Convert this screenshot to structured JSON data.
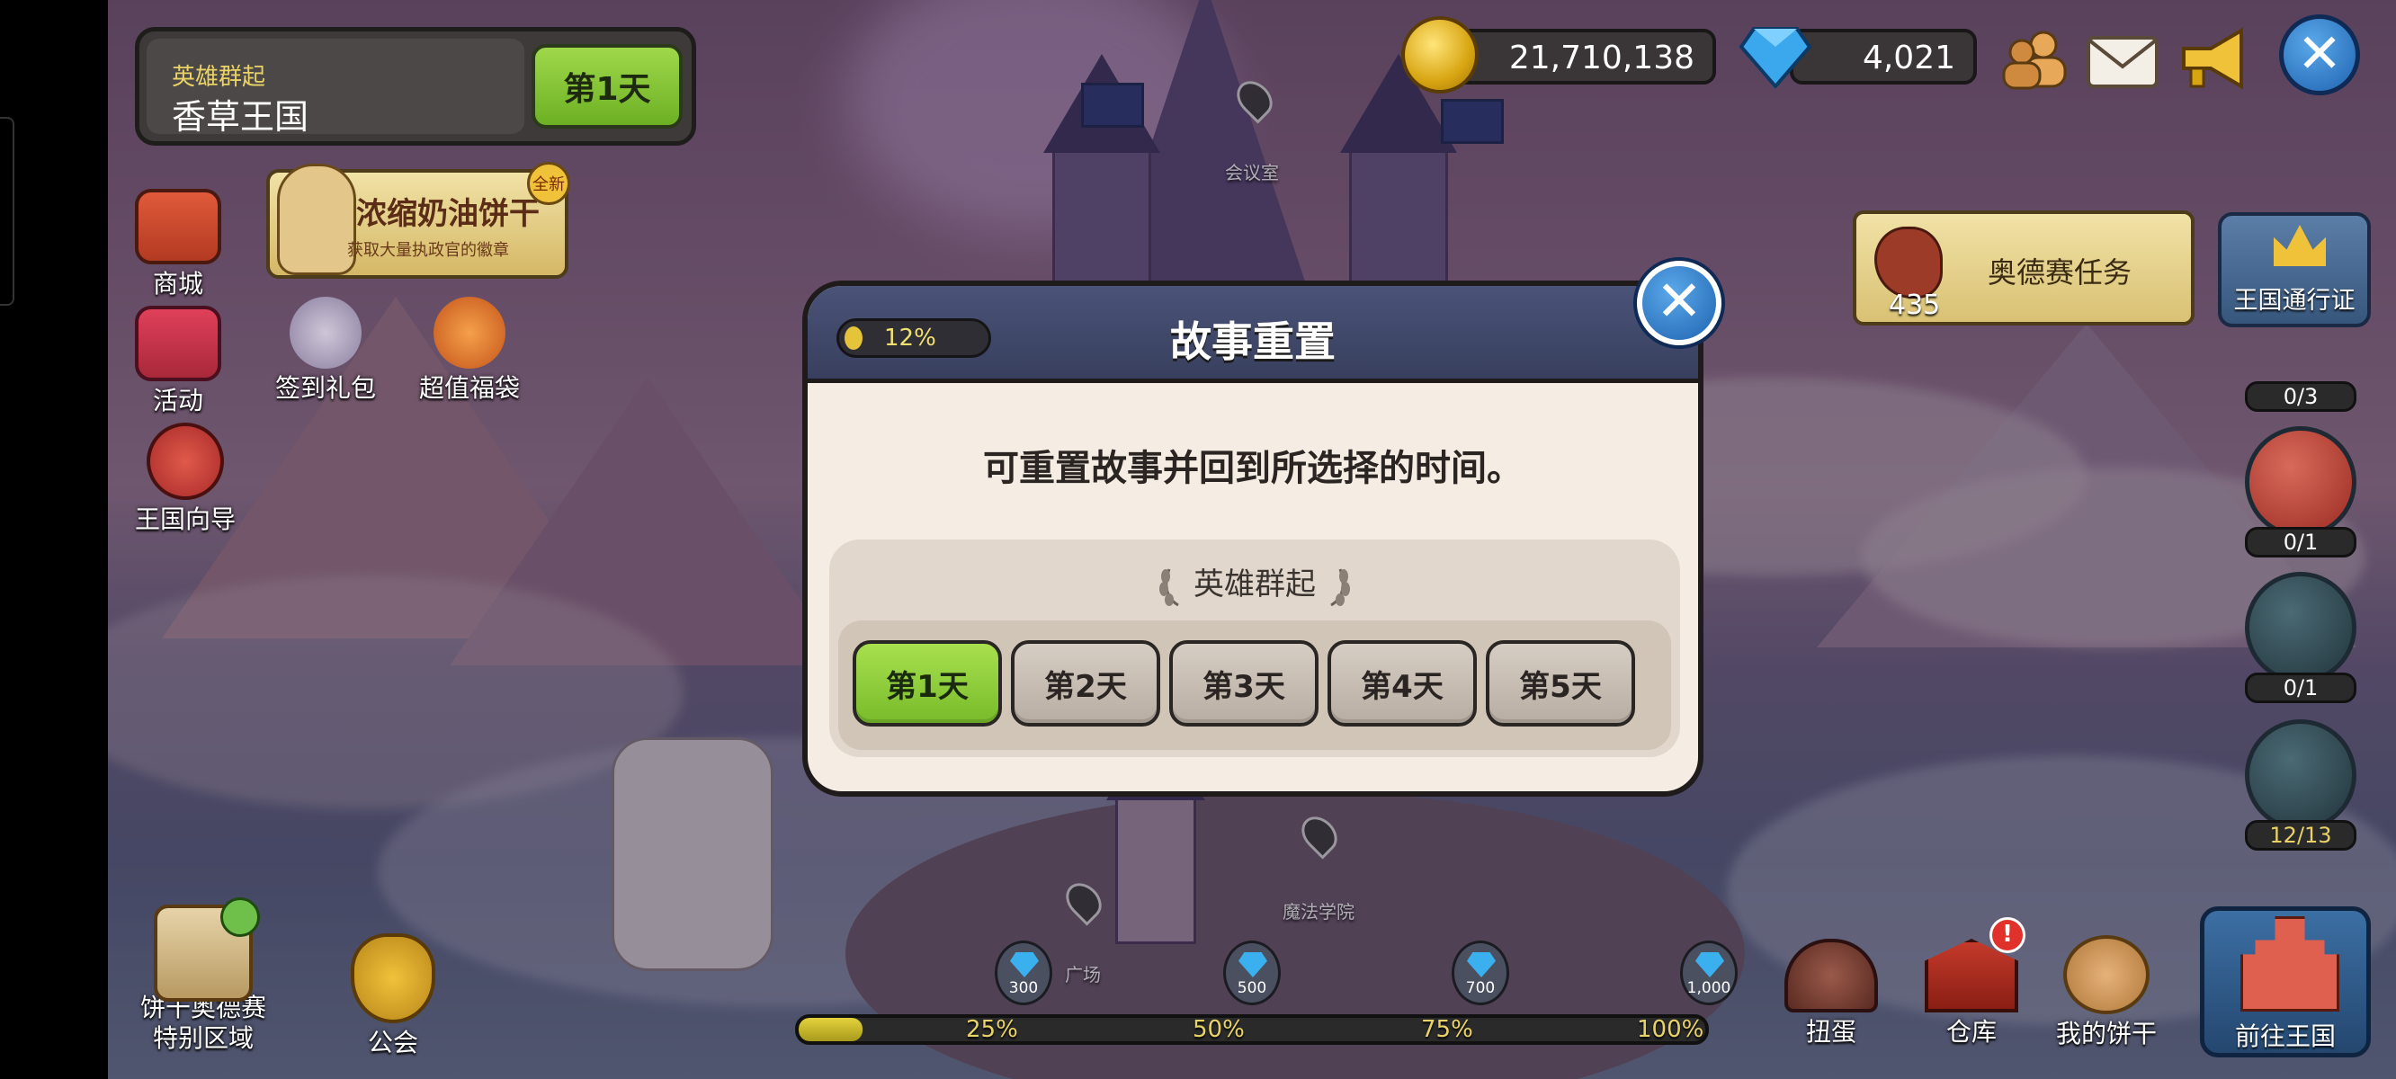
{
  "top_left": {
    "chapter_name": "英雄群起",
    "kingdom_name": "香草王国",
    "current_day": "第1天"
  },
  "left_menu": [
    {
      "label": "商城",
      "icon": "shop-icon"
    },
    {
      "label": "活动",
      "icon": "gift-box-icon"
    },
    {
      "label": "王国向导",
      "icon": "compass-icon"
    }
  ],
  "event_banner": {
    "title": "浓缩奶油饼干",
    "subtitle": "获取大量执政官的徽章",
    "tag": "全新"
  },
  "left_shortcuts": [
    {
      "label": "签到礼包",
      "icon": "calendar-gift-icon"
    },
    {
      "label": "超值福袋",
      "icon": "lucky-bag-icon"
    }
  ],
  "currency": {
    "coins": "21,710,138",
    "gems": "4,021"
  },
  "top_right_icons": [
    "friends-icon",
    "mail-icon",
    "megaphone-icon",
    "close-icon"
  ],
  "quest": {
    "label": "奥德赛任务",
    "count": "435"
  },
  "kingdom_pass": {
    "label": "王国通行证"
  },
  "side_quests": [
    {
      "progress": "0/3",
      "icon": "house-icon"
    },
    {
      "progress": "0/1",
      "icon": "sword-icon"
    },
    {
      "progress": "0/1",
      "icon": "house-pen-icon"
    },
    {
      "progress": "12/13",
      "icon": "house-pen-icon"
    }
  ],
  "map_labels": {
    "council_room": "会议室",
    "magic_academy": "魔法学院",
    "plaza": "广场"
  },
  "bottom_progress": {
    "fill_fraction": 0.07,
    "milestones": [
      {
        "pct": "25%",
        "reward": "300"
      },
      {
        "pct": "50%",
        "reward": "500"
      },
      {
        "pct": "75%",
        "reward": "700"
      },
      {
        "pct": "100%",
        "reward": "1,000"
      }
    ]
  },
  "bottom_left": [
    {
      "label": "饼干奥德赛\n特别区域",
      "icon": "map-scroll-icon"
    },
    {
      "label": "公会",
      "icon": "guild-shield-icon"
    }
  ],
  "bottom_right": [
    {
      "label": "扭蛋",
      "icon": "gacha-icon"
    },
    {
      "label": "仓库",
      "icon": "warehouse-icon",
      "alert": "!"
    },
    {
      "label": "我的饼干",
      "icon": "cookie-icon"
    },
    {
      "label": "前往王国",
      "icon": "castle-icon"
    }
  ],
  "modal": {
    "progress_pct": "12%",
    "title": "故事重置",
    "description": "可重置故事并回到所选择的时间。",
    "chapter": "英雄群起",
    "days": [
      "第1天",
      "第2天",
      "第3天",
      "第4天",
      "第5天"
    ],
    "selected_day_index": 0
  },
  "colors": {
    "active_green": "#8fcf3a",
    "header_navy": "#424a6c",
    "panel_cream": "#f5ede3",
    "gold_text": "#e9d366"
  }
}
